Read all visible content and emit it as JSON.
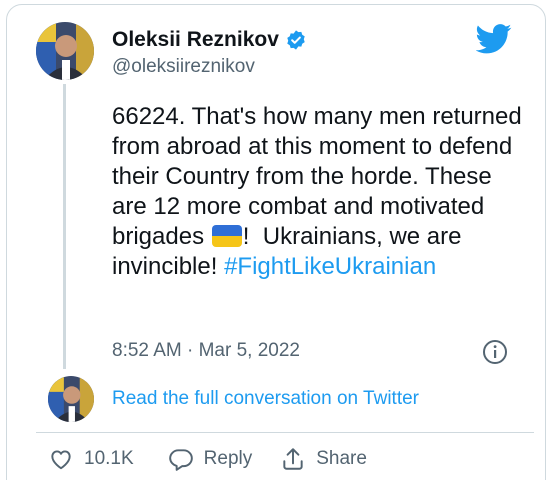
{
  "author": {
    "display_name": "Oleksii Reznikov",
    "handle": "@oleksiireznikov",
    "verified_icon": "verified-badge-icon",
    "avatar": "avatar"
  },
  "tweet": {
    "text_part1": "66224. That's how many men returned from abroad at this moment to defend their Country from the horde. These are 12 more combat and motivated brigades ",
    "flag_emoji": "ukraine-flag-emoji",
    "text_part2": "!  Ukrainians, we are invincible! ",
    "hashtag": "#FightLikeUkrainian",
    "timestamp": "8:52 AM · Mar 5, 2022"
  },
  "conversation_link": "Read the full conversation on Twitter",
  "actions": {
    "like_count": "10.1K",
    "reply_label": "Reply",
    "share_label": "Share"
  },
  "colors": {
    "accent": "#1d9bf0",
    "text": "#0f1419",
    "muted": "#536471",
    "border": "#cfd9de"
  },
  "icons": [
    "twitter-bird-icon",
    "info-icon",
    "heart-icon",
    "reply-icon",
    "share-icon"
  ]
}
